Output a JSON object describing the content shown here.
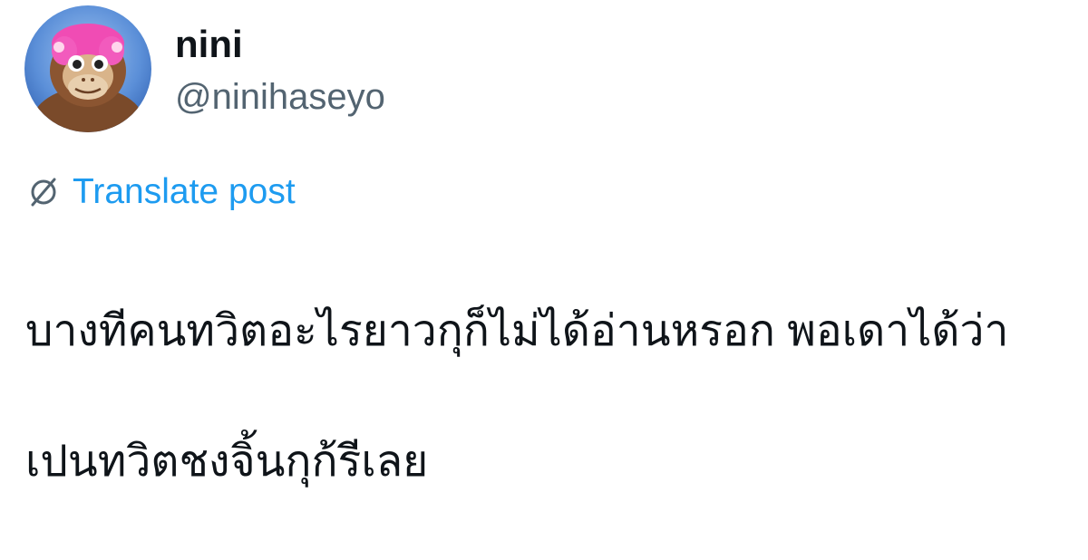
{
  "author": {
    "display_name": "nini",
    "handle": "@ninihaseyo",
    "avatar_icon": "orangutan-plush-avatar"
  },
  "translate": {
    "icon": "globe-slash-icon",
    "label": "Translate post"
  },
  "post": {
    "lines": [
      "บางทีคนทวิตอะไรยาวกุก็ไม่ได้อ่านหรอก พอเดาได้ว่า",
      "เปนทวิตชงจิ้นกุก้รีเลย"
    ]
  },
  "colors": {
    "text": "#0f1419",
    "secondary": "#536471",
    "link": "#1d9bf0"
  }
}
